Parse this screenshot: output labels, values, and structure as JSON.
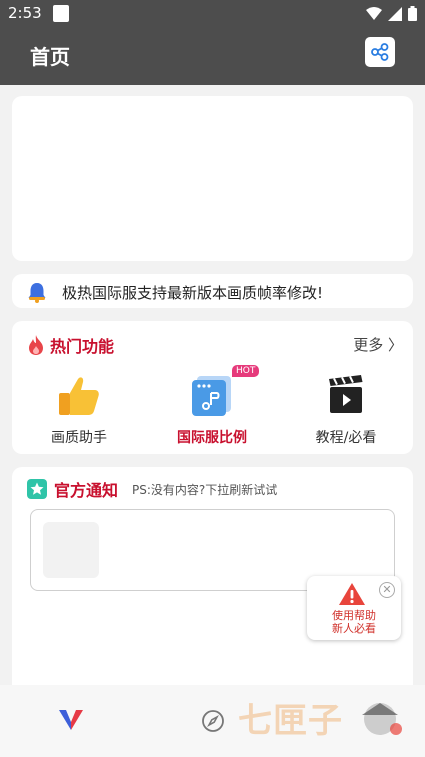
{
  "status_bar": {
    "time": "2:53"
  },
  "app_bar": {
    "title": "首页",
    "share_icon": "share-icon"
  },
  "notice": {
    "text": "极热国际服支持最新版本画质帧率修改!",
    "icon": "bell-icon"
  },
  "hot_features": {
    "title": "热门功能",
    "more_label": "更多 〉",
    "items": [
      {
        "label": "画质助手",
        "icon": "thumbs-up-icon"
      },
      {
        "label": "国际服比例",
        "icon": "app-window-icon",
        "badge": "HOT"
      },
      {
        "label": "教程/必看",
        "icon": "clapperboard-icon"
      }
    ]
  },
  "official": {
    "title": "官方通知",
    "hint": "PS:没有内容?下拉刷新试试"
  },
  "help_popup": {
    "line1": "使用帮助",
    "line2": "新人必看",
    "close": "✕"
  },
  "watermark": {
    "text": "七匣子"
  },
  "colors": {
    "accent": "#c8102e",
    "app_bar": "#4d4d4d",
    "hot_badge": "#e63a7b"
  }
}
